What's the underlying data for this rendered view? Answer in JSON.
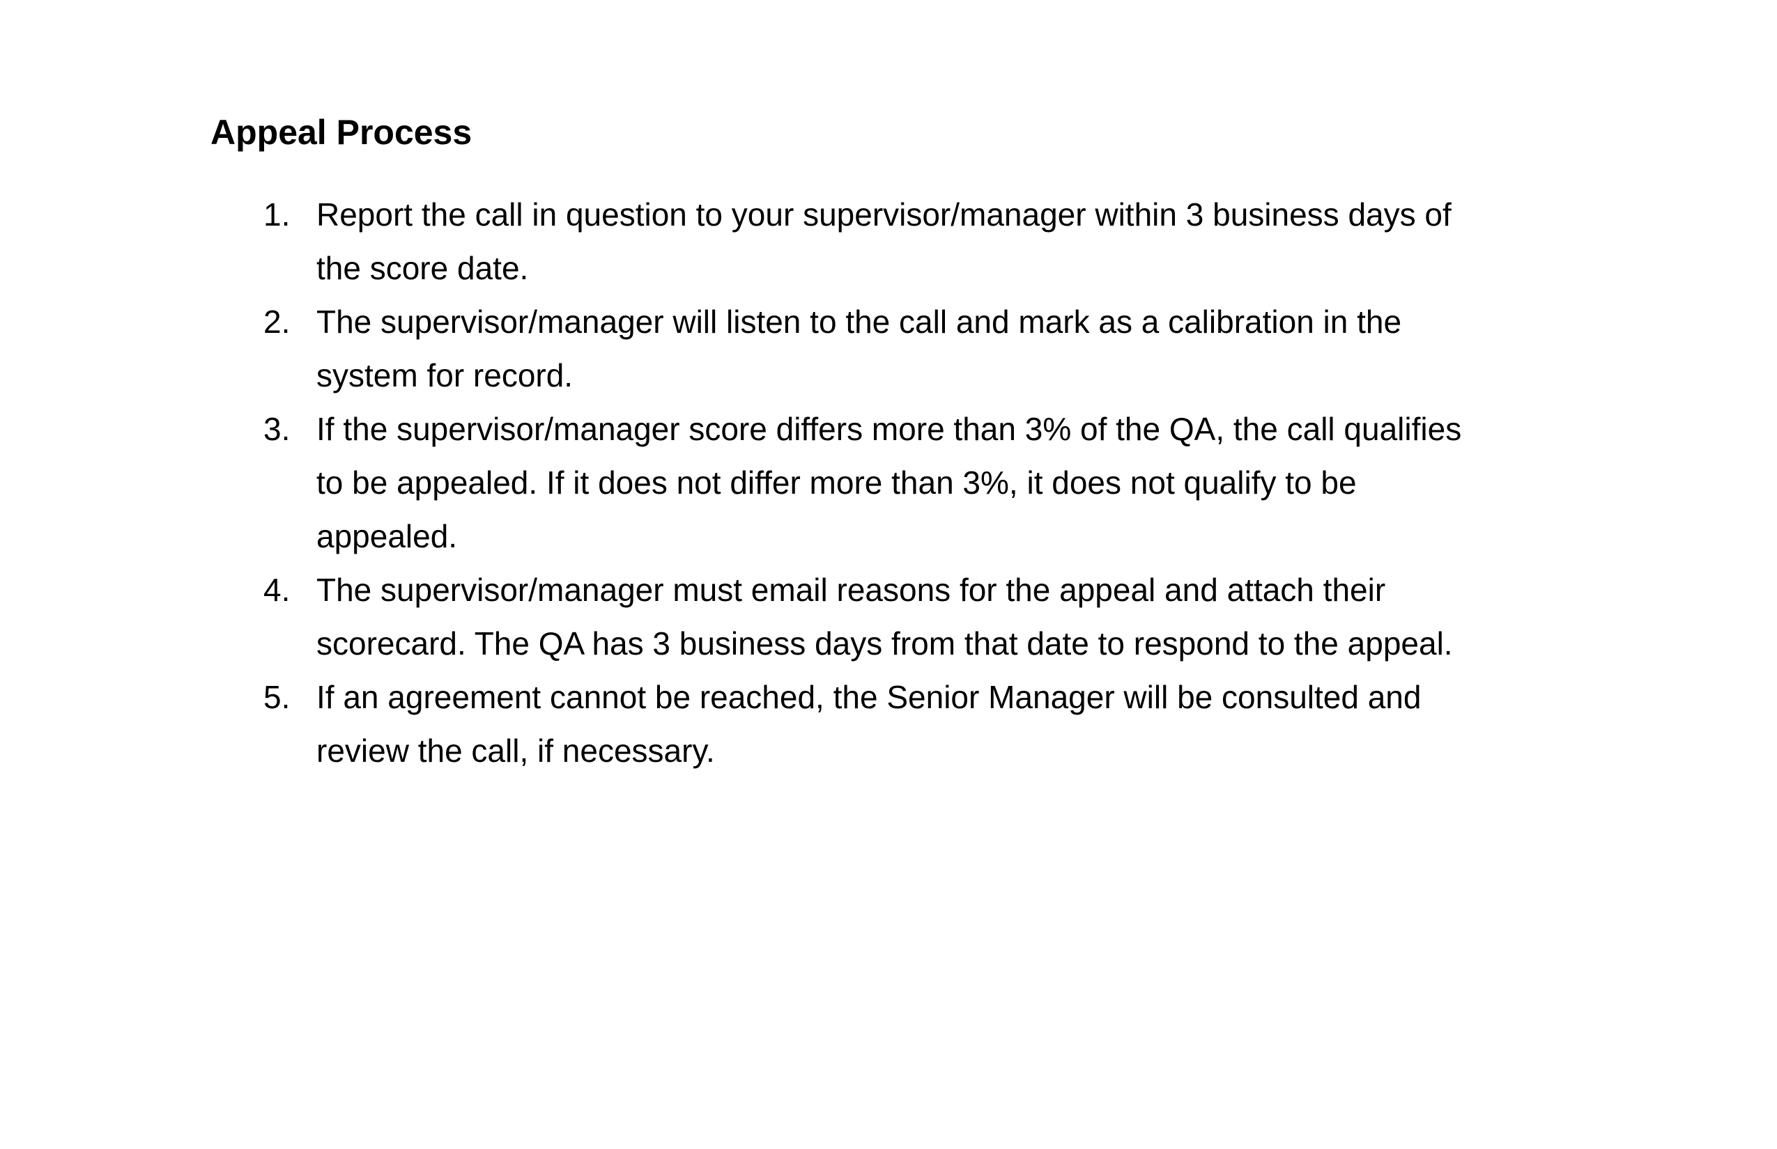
{
  "document": {
    "heading": "Appeal Process",
    "steps": [
      {
        "number": "1.",
        "lines": [
          "Report the call in question to your supervisor/manager within 3 business days of",
          "the score date."
        ]
      },
      {
        "number": "2.",
        "lines": [
          "The supervisor/manager will listen to the call and mark as a calibration in the",
          "system for record."
        ]
      },
      {
        "number": "3.",
        "lines": [
          "If the supervisor/manager score differs more than 3% of the QA, the call qualifies",
          "to be appealed. If it does not differ more than 3%, it does not qualify to be",
          "appealed."
        ]
      },
      {
        "number": "4.",
        "lines": [
          "The supervisor/manager must email reasons for the appeal and attach their",
          "scorecard. The QA has 3 business days from that date to respond to the appeal."
        ]
      },
      {
        "number": "5.",
        "lines": [
          "If an agreement cannot be reached, the Senior Manager will be consulted and",
          "review the call, if necessary."
        ]
      }
    ]
  }
}
